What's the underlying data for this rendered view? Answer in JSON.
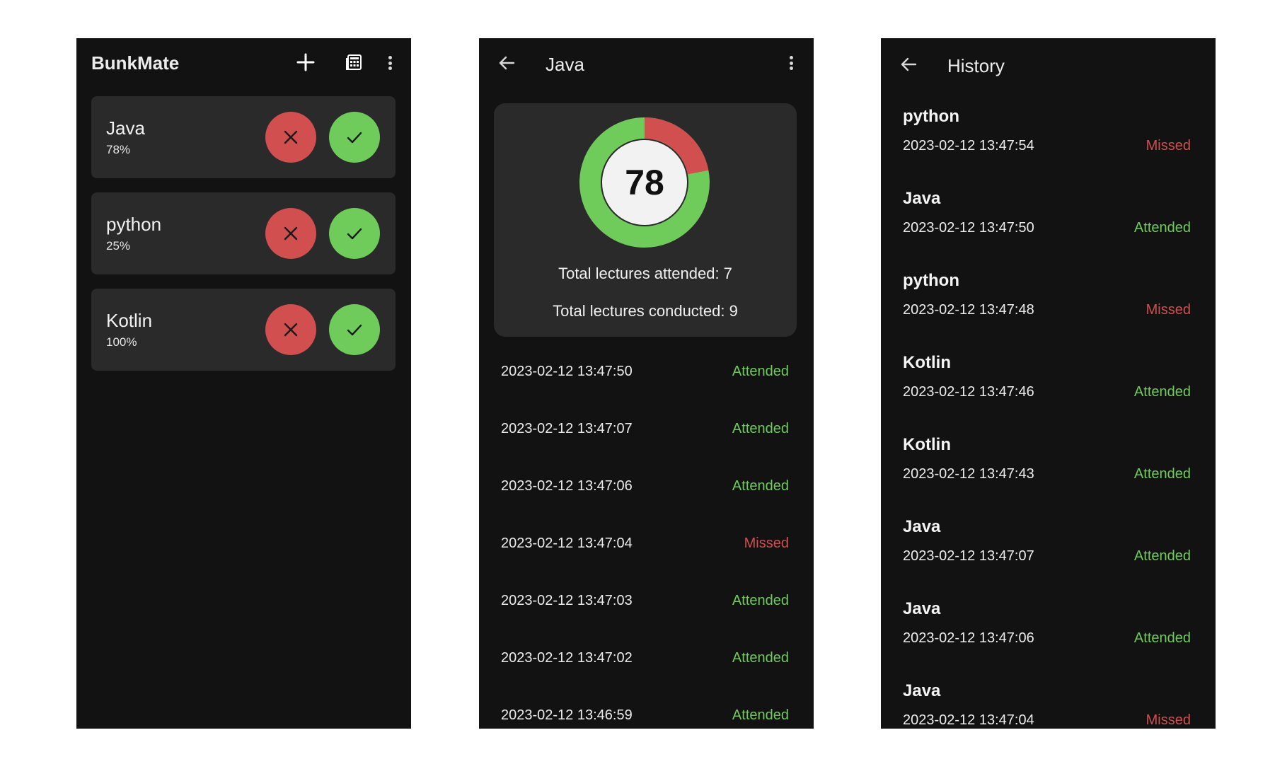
{
  "home": {
    "app_title": "BunkMate",
    "toolbar_icons": [
      "plus-icon",
      "calculator-icon",
      "more-vert-icon"
    ],
    "subjects": [
      {
        "name": "Java",
        "percent": "78%"
      },
      {
        "name": "python",
        "percent": "25%"
      },
      {
        "name": "Kotlin",
        "percent": "100%"
      }
    ],
    "colors": {
      "background": "#121212",
      "card": "#2a2a2a",
      "miss_button": "#d14f4f",
      "attend_button": "#6fcc5a"
    }
  },
  "detail": {
    "title": "Java",
    "percentage": 78,
    "percentage_label": "78",
    "attended_text": "Total lectures attended: 7",
    "conducted_text": "Total lectures conducted: 9",
    "records": [
      {
        "date": "2023-02-12 13:47:50",
        "status": "Attended"
      },
      {
        "date": "2023-02-12 13:47:07",
        "status": "Attended"
      },
      {
        "date": "2023-02-12 13:47:06",
        "status": "Attended"
      },
      {
        "date": "2023-02-12 13:47:04",
        "status": "Missed"
      },
      {
        "date": "2023-02-12 13:47:03",
        "status": "Attended"
      },
      {
        "date": "2023-02-12 13:47:02",
        "status": "Attended"
      },
      {
        "date": "2023-02-12 13:46:59",
        "status": "Attended"
      }
    ],
    "colors": {
      "attended": "#6fcc5a",
      "missed": "#d14f4f"
    }
  },
  "history": {
    "title": "History",
    "items": [
      {
        "subject": "python",
        "date": "2023-02-12 13:47:54",
        "status": "Missed"
      },
      {
        "subject": "Java",
        "date": "2023-02-12 13:47:50",
        "status": "Attended"
      },
      {
        "subject": "python",
        "date": "2023-02-12 13:47:48",
        "status": "Missed"
      },
      {
        "subject": "Kotlin",
        "date": "2023-02-12 13:47:46",
        "status": "Attended"
      },
      {
        "subject": "Kotlin",
        "date": "2023-02-12 13:47:43",
        "status": "Attended"
      },
      {
        "subject": "Java",
        "date": "2023-02-12 13:47:07",
        "status": "Attended"
      },
      {
        "subject": "Java",
        "date": "2023-02-12 13:47:06",
        "status": "Attended"
      },
      {
        "subject": "Java",
        "date": "2023-02-12 13:47:04",
        "status": "Missed"
      }
    ]
  }
}
